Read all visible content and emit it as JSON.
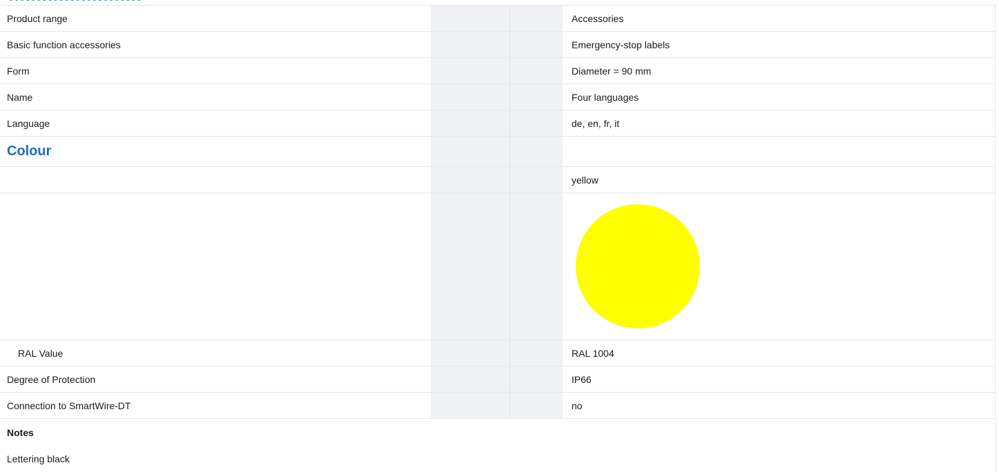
{
  "rows": [
    {
      "label": "Product range",
      "value": "Accessories"
    },
    {
      "label": "Basic function accessories",
      "value": "Emergency-stop labels"
    },
    {
      "label": "Form",
      "value": "Diameter = 90 mm"
    },
    {
      "label": "Name",
      "value": "Four languages"
    },
    {
      "label": "Language",
      "value": "de, en, fr, it"
    }
  ],
  "colour": {
    "heading": "Colour",
    "value": "yellow",
    "swatch_color": "#ffff00",
    "ral_label": "RAL Value",
    "ral_value": "RAL 1004"
  },
  "rows_after": [
    {
      "label": "Degree of Protection",
      "value": "IP66"
    },
    {
      "label": "Connection to SmartWire-DT",
      "value": "no"
    }
  ],
  "notes": {
    "title": "Notes",
    "text": "Lettering black"
  },
  "colors": {
    "heading_blue": "#1f6fb5",
    "shaded_column": "#eff1f5",
    "row_divider": "#e6e8eb"
  }
}
